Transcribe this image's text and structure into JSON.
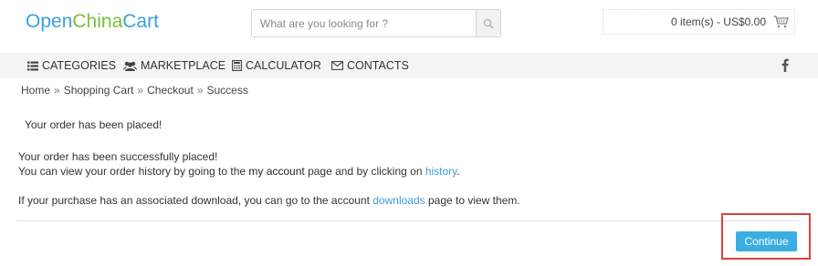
{
  "header": {
    "logo": {
      "part1": "Open",
      "part2": "China",
      "part3": "Cart"
    },
    "search": {
      "placeholder": "What are you looking for ?"
    },
    "cart": {
      "text": "0 item(s) - US$0.00"
    }
  },
  "nav": {
    "items": [
      {
        "label": "CATEGORIES",
        "icon": "list-icon"
      },
      {
        "label": "MARKETPLACE",
        "icon": "users-icon"
      },
      {
        "label": "CALCULATOR",
        "icon": "calculator-icon"
      },
      {
        "label": "CONTACTS",
        "icon": "envelope-icon"
      }
    ],
    "social_icon": "facebook-icon"
  },
  "breadcrumb": [
    "Home",
    "Shopping Cart",
    "Checkout",
    "Success"
  ],
  "breadcrumb_separator": "»",
  "content": {
    "heading": "Your order has been placed!",
    "line1": "Your order has been successfully placed!",
    "line2_a": "You can view your order history by going to the ",
    "line2_link1": "my account",
    "line2_b": " page and by clicking on ",
    "line2_link2": "history",
    "line2_c": ".",
    "line3_a": "If your purchase has an associated download, you can go to the account ",
    "line3_link": "downloads",
    "line3_b": " page to view them."
  },
  "actions": {
    "continue_label": "Continue"
  },
  "colors": {
    "accent": "#3aaee0",
    "logo_blue": "#3aa0d8",
    "logo_green": "#7bbf3a",
    "highlight": "#e0403b"
  }
}
